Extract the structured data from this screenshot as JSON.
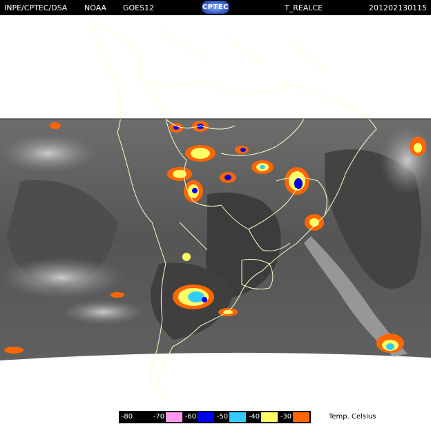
{
  "header": {
    "source": "INPE/CPTEC/DSA",
    "agency": "NOAA",
    "satellite": "GOES12",
    "logo_text": "CPTEC",
    "product": "T_REALCE",
    "timestamp": "201202130115"
  },
  "legend": {
    "items": [
      {
        "value": "-80",
        "color": "#000000"
      },
      {
        "value": "-70",
        "color": "#ff99ee"
      },
      {
        "value": "-60",
        "color": "#0000ee"
      },
      {
        "value": "-50",
        "color": "#33ccff"
      },
      {
        "value": "-40",
        "color": "#ffff66"
      },
      {
        "value": "-30",
        "color": "#ff6600"
      }
    ],
    "label": "Temp. Celsius"
  },
  "colors": {
    "background": "#ffffff",
    "header_bg": "#000000",
    "boundary": "#ffffcc",
    "ir_dark": "#3a3a3a"
  }
}
